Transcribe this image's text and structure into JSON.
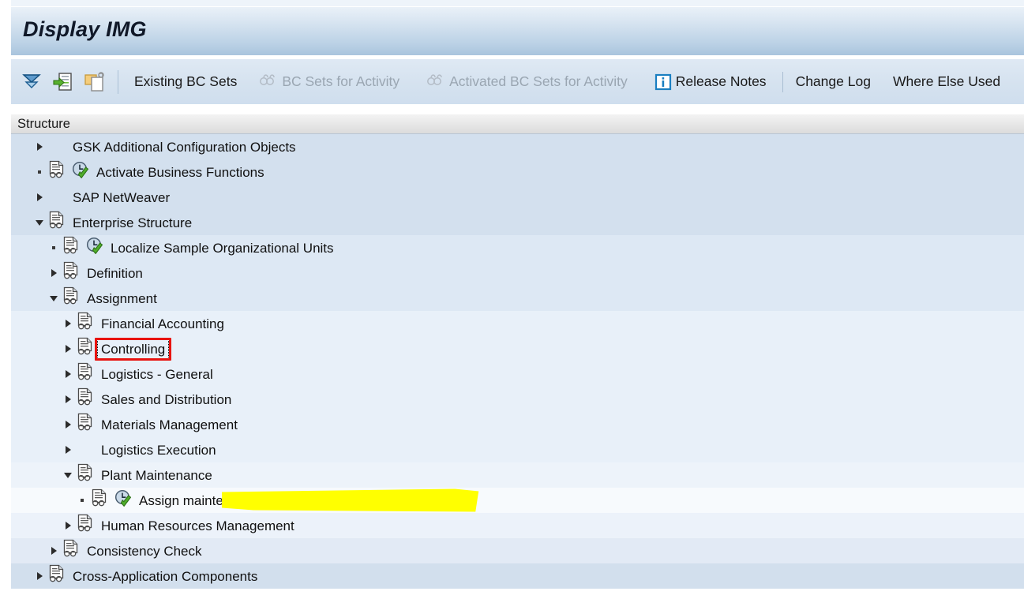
{
  "window": {
    "title": "Display IMG"
  },
  "toolbar": {
    "icons": [
      {
        "name": "collapse-all-icon",
        "label": ""
      },
      {
        "name": "expand-node-icon",
        "label": ""
      },
      {
        "name": "copy-structure-icon",
        "label": ""
      }
    ],
    "buttons": [
      {
        "name": "existing-bc-sets-button",
        "label": "Existing BC Sets",
        "icon": "none",
        "disabled": false
      },
      {
        "name": "bc-sets-for-activity-button",
        "label": "BC Sets for Activity",
        "icon": "bc-set-icon",
        "disabled": true
      },
      {
        "name": "activated-bc-sets-for-activity-button",
        "label": "Activated BC Sets for Activity",
        "icon": "bc-set-icon",
        "disabled": true
      },
      {
        "name": "release-notes-button",
        "label": "Release Notes",
        "icon": "info-icon",
        "disabled": false
      },
      {
        "name": "change-log-button",
        "label": "Change Log",
        "icon": "none",
        "disabled": false
      },
      {
        "name": "where-else-used-button",
        "label": "Where Else Used",
        "icon": "none",
        "disabled": false
      }
    ]
  },
  "column_header": {
    "structure_label": "Structure"
  },
  "tree": {
    "rows": [
      {
        "label": "GSK Additional Configuration Objects",
        "depth": 0,
        "twisty": "closed",
        "icon": "none",
        "band": "a",
        "selected": false
      },
      {
        "label": "Activate Business Functions",
        "depth": 0,
        "twisty": "leaf",
        "icon": "doc-clock",
        "band": "a",
        "selected": false
      },
      {
        "label": "SAP NetWeaver",
        "depth": 0,
        "twisty": "closed",
        "icon": "none",
        "band": "a",
        "selected": false
      },
      {
        "label": "Enterprise Structure",
        "depth": 0,
        "twisty": "open",
        "icon": "doc",
        "band": "a",
        "selected": false
      },
      {
        "label": "Localize Sample Organizational Units",
        "depth": 1,
        "twisty": "leaf",
        "icon": "doc-clock",
        "band": "b",
        "selected": false
      },
      {
        "label": "Definition",
        "depth": 1,
        "twisty": "closed",
        "icon": "doc",
        "band": "b",
        "selected": false
      },
      {
        "label": "Assignment",
        "depth": 1,
        "twisty": "open",
        "icon": "doc",
        "band": "b",
        "selected": false
      },
      {
        "label": "Financial Accounting",
        "depth": 2,
        "twisty": "closed",
        "icon": "doc",
        "band": "c",
        "selected": false
      },
      {
        "label": "Controlling",
        "depth": 2,
        "twisty": "closed",
        "icon": "doc",
        "band": "c",
        "selected": true
      },
      {
        "label": "Logistics - General",
        "depth": 2,
        "twisty": "closed",
        "icon": "doc",
        "band": "c",
        "selected": false
      },
      {
        "label": "Sales and Distribution",
        "depth": 2,
        "twisty": "closed",
        "icon": "doc",
        "band": "c",
        "selected": false
      },
      {
        "label": "Materials Management",
        "depth": 2,
        "twisty": "closed",
        "icon": "doc",
        "band": "c",
        "selected": false
      },
      {
        "label": "Logistics Execution",
        "depth": 2,
        "twisty": "closed",
        "icon": "none",
        "band": "c",
        "selected": false
      },
      {
        "label": "Plant Maintenance",
        "depth": 2,
        "twisty": "open",
        "icon": "doc",
        "band": "d",
        "selected": false
      },
      {
        "label": "Assign maintenance planning plant to maintenance plant",
        "depth": 3,
        "twisty": "leaf",
        "icon": "doc-clock",
        "band": "e",
        "selected": false
      },
      {
        "label": "Human Resources Management",
        "depth": 2,
        "twisty": "closed",
        "icon": "doc",
        "band": "f",
        "selected": false
      },
      {
        "label": "Consistency Check",
        "depth": 1,
        "twisty": "closed",
        "icon": "doc",
        "band": "g",
        "selected": false
      },
      {
        "label": "Cross-Application Components",
        "depth": 0,
        "twisty": "closed",
        "icon": "doc",
        "band": "h",
        "selected": false
      }
    ]
  },
  "annotations": {
    "selection_box": {
      "name": "controlling-annotation-box",
      "color": "#e8130f"
    },
    "highlighter": {
      "name": "assign-maintenance-planning-plant-highlight",
      "color": "#ffff00"
    }
  },
  "colors": {
    "band_a": "#d3e0ee",
    "band_b": "#dde8f4",
    "band_c": "#e8f0f9",
    "band_d": "#edf3fa",
    "band_e": "#f7fafd",
    "band_f": "#ecf2fa",
    "band_g": "#e2eaf5",
    "band_h": "#d2dfed",
    "title_accent": "#a9c4dd",
    "annotation_red": "#e8130f",
    "highlighter_yellow": "#ffff00"
  }
}
